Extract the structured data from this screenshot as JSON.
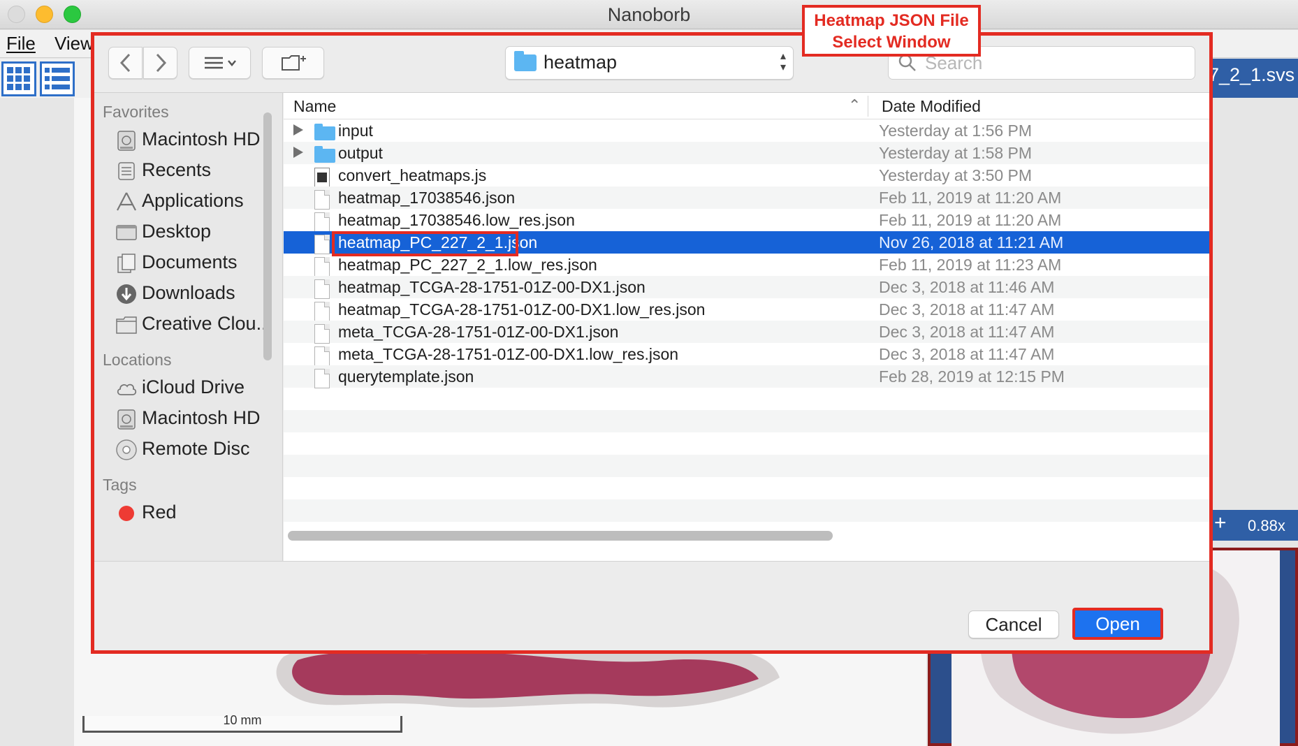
{
  "app": {
    "title": "Nanoborb",
    "menu": {
      "file": "File",
      "view": "View"
    },
    "file_tab": "7_2_1.svs",
    "zoom": "0.88x",
    "scale_bar": "10 mm"
  },
  "annotation": {
    "callout_line1": "Heatmap JSON File",
    "callout_line2": "Select Window"
  },
  "dialog": {
    "location": "heatmap",
    "search_placeholder": "Search",
    "sidebar": {
      "favorites_heading": "Favorites",
      "favorites": [
        {
          "label": "Macintosh HD",
          "icon": "hard-drive-icon"
        },
        {
          "label": "Recents",
          "icon": "recents-icon"
        },
        {
          "label": "Applications",
          "icon": "applications-icon"
        },
        {
          "label": "Desktop",
          "icon": "desktop-icon"
        },
        {
          "label": "Documents",
          "icon": "documents-icon"
        },
        {
          "label": "Downloads",
          "icon": "downloads-icon"
        },
        {
          "label": "Creative Clou...",
          "icon": "folder-icon"
        }
      ],
      "locations_heading": "Locations",
      "locations": [
        {
          "label": "iCloud Drive",
          "icon": "cloud-icon"
        },
        {
          "label": "Macintosh HD",
          "icon": "hard-drive-icon"
        },
        {
          "label": "Remote Disc",
          "icon": "disc-icon"
        }
      ],
      "tags_heading": "Tags",
      "tags": [
        {
          "label": "Red",
          "color": "#ee3b34"
        }
      ]
    },
    "columns": {
      "name": "Name",
      "date": "Date Modified"
    },
    "files": [
      {
        "name": "input",
        "date": "Yesterday at 1:56 PM",
        "type": "folder"
      },
      {
        "name": "output",
        "date": "Yesterday at 1:58 PM",
        "type": "folder"
      },
      {
        "name": "convert_heatmaps.js",
        "date": "Yesterday at 3:50 PM",
        "type": "exec"
      },
      {
        "name": "heatmap_17038546.json",
        "date": "Feb 11, 2019 at 11:20 AM",
        "type": "doc"
      },
      {
        "name": "heatmap_17038546.low_res.json",
        "date": "Feb 11, 2019 at 11:20 AM",
        "type": "doc"
      },
      {
        "name": "heatmap_PC_227_2_1.json",
        "date": "Nov 26, 2018 at 11:21 AM",
        "type": "doc",
        "selected": true
      },
      {
        "name": "heatmap_PC_227_2_1.low_res.json",
        "date": "Feb 11, 2019 at 11:23 AM",
        "type": "doc"
      },
      {
        "name": "heatmap_TCGA-28-1751-01Z-00-DX1.json",
        "date": "Dec 3, 2018 at 11:46 AM",
        "type": "doc"
      },
      {
        "name": "heatmap_TCGA-28-1751-01Z-00-DX1.low_res.json",
        "date": "Dec 3, 2018 at 11:47 AM",
        "type": "doc"
      },
      {
        "name": "meta_TCGA-28-1751-01Z-00-DX1.json",
        "date": "Dec 3, 2018 at 11:47 AM",
        "type": "doc"
      },
      {
        "name": "meta_TCGA-28-1751-01Z-00-DX1.low_res.json",
        "date": "Dec 3, 2018 at 11:47 AM",
        "type": "doc"
      },
      {
        "name": "querytemplate.json",
        "date": "Feb 28, 2019 at 12:15 PM",
        "type": "doc"
      }
    ],
    "buttons": {
      "cancel": "Cancel",
      "open": "Open"
    },
    "colors": {
      "selection": "#1662d7",
      "accent": "#1d72ef",
      "annotation": "#e32b22"
    }
  }
}
